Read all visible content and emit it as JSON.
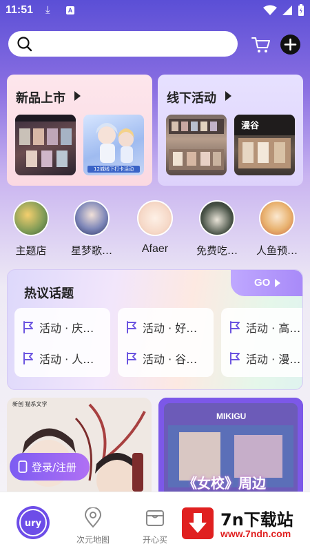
{
  "status_bar": {
    "time": "11:51"
  },
  "search": {
    "placeholder": "",
    "value": ""
  },
  "promos": [
    {
      "title": "新品上市",
      "thumb_text": "12城线下打卡活动"
    },
    {
      "title": "线下活动",
      "thumb_text": "漫谷"
    }
  ],
  "categories": [
    {
      "label": "主题店"
    },
    {
      "label": "星梦歌…"
    },
    {
      "label": "Afaer"
    },
    {
      "label": "免费吃…"
    },
    {
      "label": "人鱼预…"
    }
  ],
  "topics": {
    "title": "热议话题",
    "go_label": "GO",
    "columns": [
      [
        "活动 · 庆…",
        "活动 · 人…"
      ],
      [
        "活动 · 好…",
        "活动 · 谷…"
      ],
      [
        "活动 · 高…",
        "活动 · 漫…"
      ]
    ]
  },
  "feed": {
    "left_caption": "新创 猫系文学",
    "right_caption": "《女校》周边",
    "right_sign": "MIKIGU"
  },
  "login": {
    "label": "登录/注册"
  },
  "nav": {
    "items": [
      {
        "label": "次元地图"
      },
      {
        "label": "开心买"
      }
    ]
  },
  "watermark": {
    "title": "7n下载站",
    "url": "www.7ndn.com"
  },
  "colors": {
    "accent": "#6d4de8",
    "topic_flag": "#6b54e0",
    "watermark_red": "#e02020"
  }
}
